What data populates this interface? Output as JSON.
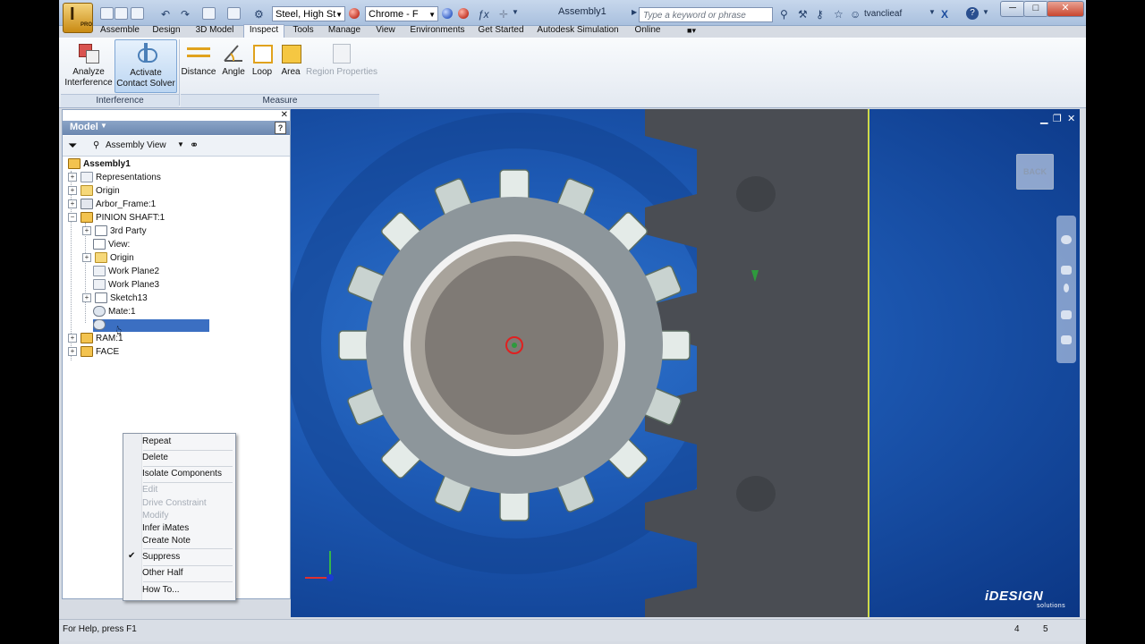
{
  "titlebar": {
    "material": "Steel, High St",
    "appearance": "Chrome - F",
    "document_title": "Assembly1",
    "search_placeholder": "Type a keyword or phrase",
    "user": "tvanclieaf",
    "app_letter": "I",
    "app_edition": "PRO"
  },
  "tabs": [
    "Assemble",
    "Design",
    "3D Model",
    "Inspect",
    "Tools",
    "Manage",
    "View",
    "Environments",
    "Get Started",
    "Autodesk Simulation",
    "Online"
  ],
  "active_tab": "Inspect",
  "ribbon": {
    "analyze_interference": [
      "Analyze",
      "Interference"
    ],
    "activate_contact_solver": [
      "Activate",
      "Contact Solver"
    ],
    "distance": "Distance",
    "angle": "Angle",
    "loop": "Loop",
    "area": "Area",
    "region_properties": "Region Properties",
    "panel_interference": "Interference",
    "panel_measure": "Measure"
  },
  "browser": {
    "title": "Model",
    "view": "Assembly View",
    "help_icon": "?",
    "nodes": [
      {
        "label": "Assembly1",
        "icon": "assembly-icon"
      },
      {
        "label": "Representations",
        "icon": "representations-icon"
      },
      {
        "label": "Origin",
        "icon": "folder-icon"
      },
      {
        "label": "Arbor_Frame:1",
        "icon": "part-icon"
      },
      {
        "label": "PINION SHAFT:1",
        "icon": "subassembly-icon"
      },
      {
        "label": "3rd Party",
        "icon": "third-party-icon"
      },
      {
        "label": "View:",
        "icon": "view-icon"
      },
      {
        "label": "Origin",
        "icon": "folder-icon"
      },
      {
        "label": "Work Plane2",
        "icon": "work-plane-icon"
      },
      {
        "label": "Work Plane3",
        "icon": "work-plane-icon"
      },
      {
        "label": "Sketch13",
        "icon": "sketch-icon"
      },
      {
        "label": "Mate:1",
        "icon": "mate-icon"
      },
      {
        "label": "RAM:1",
        "icon": "subassembly-icon"
      },
      {
        "label": "FACE",
        "icon": "subassembly-icon"
      }
    ]
  },
  "context_menu": {
    "items": [
      {
        "label": "Repeat",
        "enabled": true
      },
      {
        "label": "Delete",
        "enabled": true
      },
      {
        "label": "Isolate Components",
        "enabled": true
      },
      {
        "label": "Edit",
        "enabled": false
      },
      {
        "label": "Drive Constraint",
        "enabled": false
      },
      {
        "label": "Modify",
        "enabled": false
      },
      {
        "label": "Infer iMates",
        "enabled": true
      },
      {
        "label": "Create Note",
        "enabled": true
      },
      {
        "label": "Suppress",
        "enabled": true,
        "checked": true
      },
      {
        "label": "Other Half",
        "enabled": true
      },
      {
        "label": "How To...",
        "enabled": true
      }
    ]
  },
  "viewport": {
    "back_label": "BACK",
    "logo": "iDESIGN",
    "logo_sub": "solutions",
    "bg_color": "#1d59b3"
  },
  "status": {
    "help": "For Help, press F1",
    "count_a": "4",
    "count_b": "5"
  }
}
